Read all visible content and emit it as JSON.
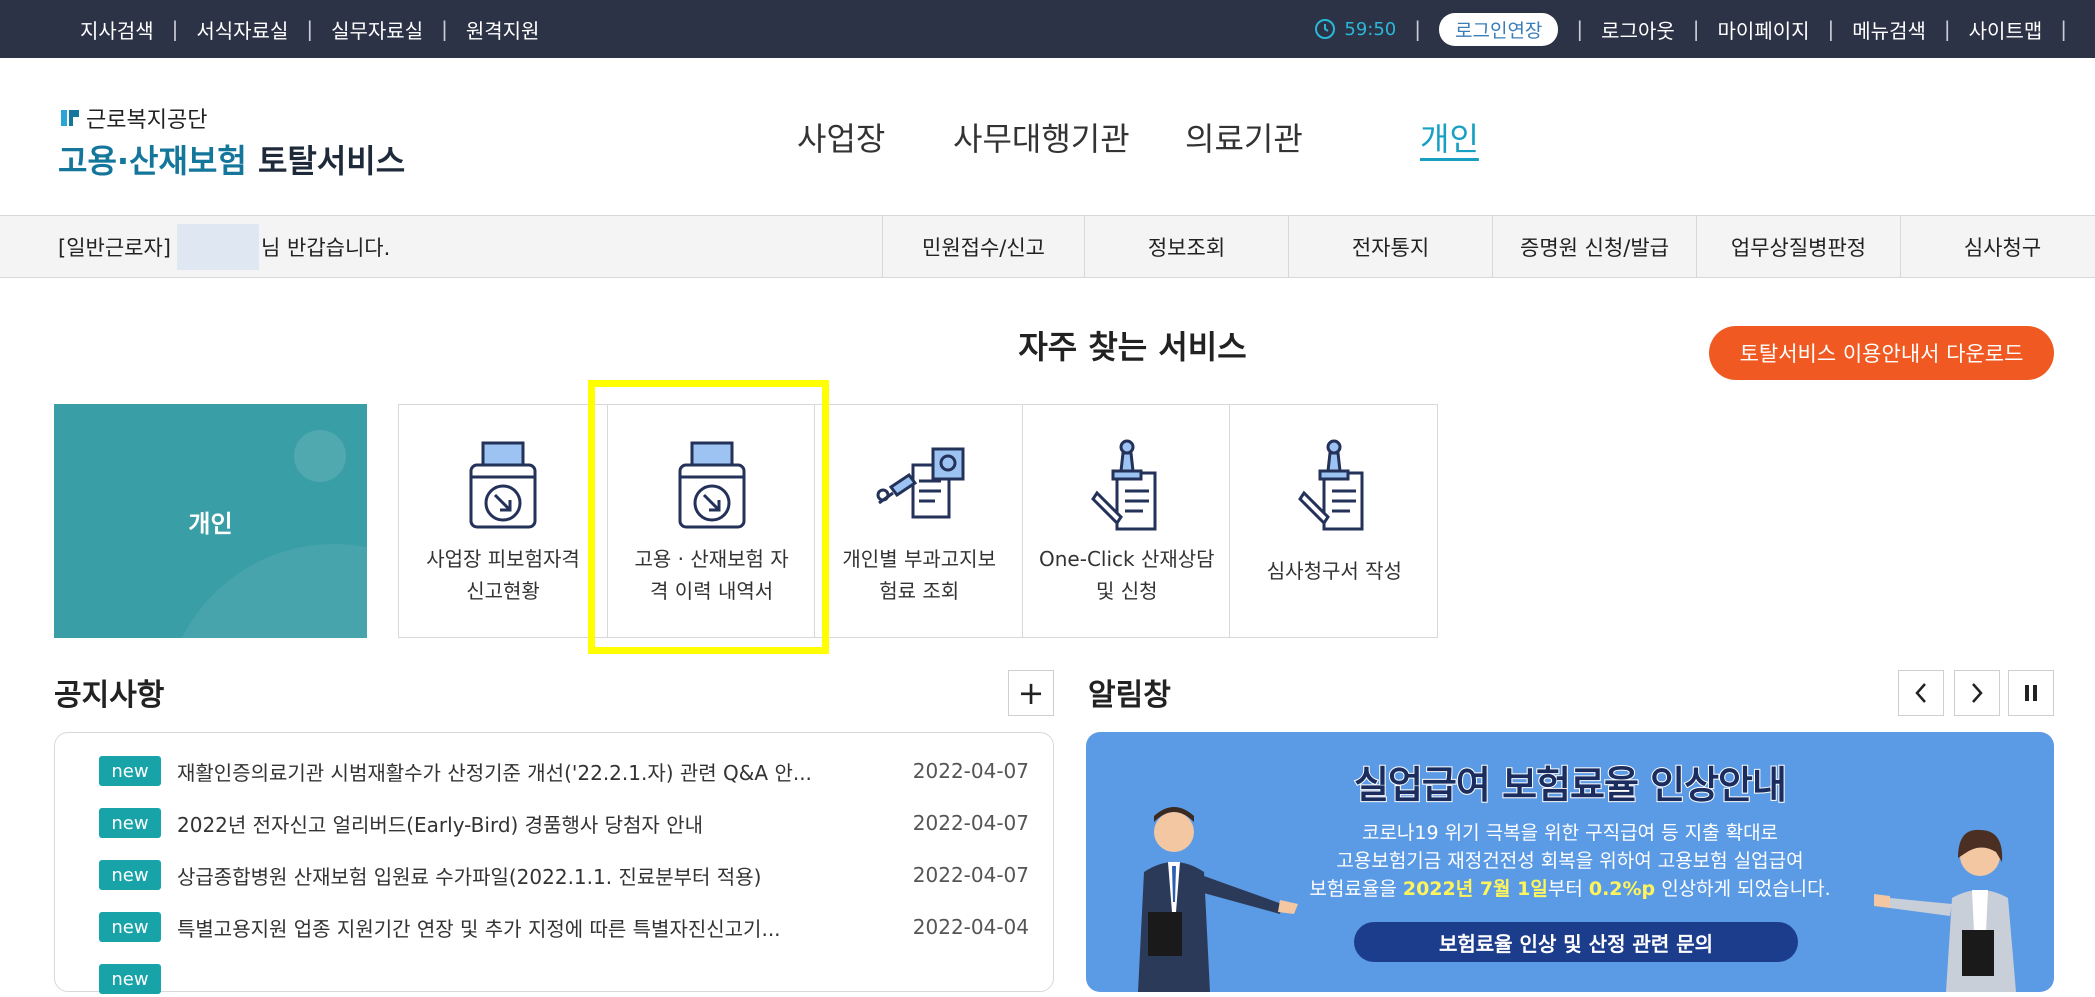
{
  "topbar": {
    "left_items": [
      "지사검색",
      "서식자료실",
      "실무자료실",
      "원격지원"
    ],
    "timer": "59:50",
    "login_extend": "로그인연장",
    "right_items": [
      "로그아웃",
      "마이페이지",
      "메뉴검색",
      "사이트맵"
    ]
  },
  "logo": {
    "org": "근로복지공단",
    "title_a": "고용·산재보험",
    "title_b": "토탈서비스"
  },
  "mainnav": [
    "사업장",
    "사무대행기관",
    "의료기관",
    "개인"
  ],
  "greeting": {
    "prefix": "[일반근로자]",
    "suffix": "님 반갑습니다."
  },
  "submenu": [
    "민원접수/신고",
    "정보조회",
    "전자통지",
    "증명원 신청/발급",
    "업무상질병판정",
    "심사청구"
  ],
  "favorites": {
    "title": "자주 찾는 서비스",
    "download": "토탈서비스 이용안내서 다운로드",
    "personal_label": "개인",
    "services": [
      {
        "line1": "사업장 피보험자격",
        "line2": "신고현황",
        "icon": "printer-download-icon"
      },
      {
        "line1": "고용 · 산재보험 자",
        "line2": "격 이력 내역서",
        "icon": "printer-download-icon"
      },
      {
        "line1": "개인별 부과고지보",
        "line2": "험료 조회",
        "icon": "document-search-icon"
      },
      {
        "line1": "One-Click 산재상담",
        "line2": "및 신청",
        "icon": "stamp-document-icon"
      },
      {
        "line1": "심사청구서 작성",
        "line2": "",
        "icon": "stamp-document-icon"
      }
    ]
  },
  "notice": {
    "title": "공지사항",
    "more": "+",
    "badge": "new",
    "items": [
      {
        "text": "재활인증의료기관 시범재활수가 산정기준 개선('22.2.1.자) 관련 Q&A 안...",
        "date": "2022-04-07"
      },
      {
        "text": "2022년 전자신고 얼리버드(Early-Bird) 경품행사 당첨자 안내",
        "date": "2022-04-07"
      },
      {
        "text": "상급종합병원 산재보험 입원료 수가파일(2022.1.1. 진료분부터 적용)",
        "date": "2022-04-07"
      },
      {
        "text": "특별고용지원 업종 지원기간 연장 및 추가 지정에 따른 특별자진신고기...",
        "date": "2022-04-04"
      }
    ]
  },
  "alert": {
    "title": "알림창",
    "banner_title": "실업급여 보험료율 인상안내",
    "line1": "코로나19 위기 극복을 위한 구직급여 등 지출 확대로",
    "line2": "고용보험기금 재정건전성 회복을 위하여 고용보험 실업급여",
    "line3_a": "보험료율을",
    "line3_b": "2022년 7월 1일",
    "line3_c": "부터",
    "line3_d": "0.2%p",
    "line3_e": "인상하게 되었습니다.",
    "button": "보험료율 인상 및 산정 관련 문의"
  },
  "colors": {
    "topbar": "#2d3346",
    "accent": "#18a0c3",
    "download": "#f05a22",
    "badge": "#18a3a8",
    "highlight": "#ffff00"
  }
}
